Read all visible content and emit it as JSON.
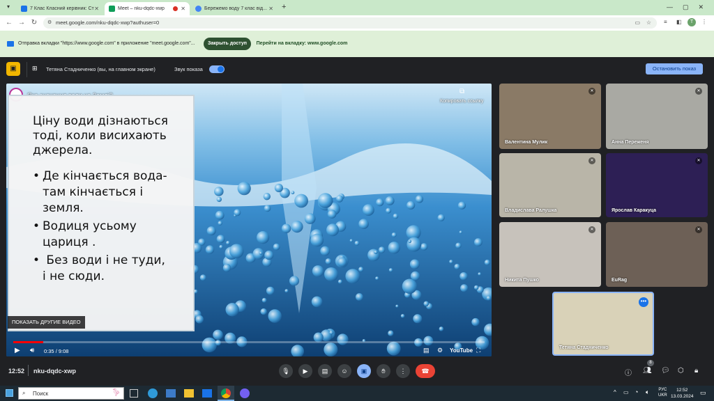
{
  "browser": {
    "tabs": [
      {
        "label": "7 Клас Класний керівник: Ста...",
        "color": "#1a73e8"
      },
      {
        "label": "Meet – nku-dqdc-xwp",
        "color": "#0f9d58"
      },
      {
        "label": "Бережемо воду 7 клас від...",
        "color": "#4285f4"
      }
    ],
    "new_tab": "+",
    "url": "meet.google.com/nku-dqdc-xwp?authuser=0",
    "profile_initial": "T"
  },
  "infobar": {
    "message": "Отправка вкладки \"https://www.google.com\" в приложение \"meet.google.com\"...",
    "close_access": "Закрыть доступ",
    "go_tab": "Перейти на вкладку: www.google.com"
  },
  "meet_top": {
    "presenter": "Тетяна Стадниченко (вы, на главном экране)",
    "sound_label": "Звук показа",
    "stop_button": "Остановить показ"
  },
  "video": {
    "title": "Яке значення води на Землі?",
    "copy_link": "Копировать ссылку",
    "more_videos": "ПОКАЗАТЬ ДРУГИЕ ВИДЕО",
    "time_current": "0:35",
    "time_total": "9:08",
    "progress": 0.064,
    "youtube": "YouTube",
    "slide_lines": [
      "Ціну води дізнаються",
      "тоді, коли висихають",
      "джерела."
    ],
    "bullets": [
      [
        "Де кінчається вода-",
        "там кінчається і",
        "земля."
      ],
      [
        "Водиця усьому",
        "цариця ."
      ],
      [
        " Без води і не туди,",
        "і не сюди."
      ]
    ]
  },
  "participants": [
    {
      "name": "Валентина Мулик",
      "bg": "#8a7a66"
    },
    {
      "name": "Анна Переженя",
      "bg": "#a9a9a3"
    },
    {
      "name": "Владислава Ралушка",
      "bg": "#b9b5a8"
    },
    {
      "name": "Ярослав Каракуца",
      "bg": "#2d1f55"
    },
    {
      "name": "Никита Пушко",
      "bg": "#c7c2bb"
    },
    {
      "name": "EuRag",
      "bg": "#6d6056"
    },
    {
      "name": "Тетяна Стадниченко",
      "bg": "#d9d2b8"
    }
  ],
  "bottom": {
    "time": "12:52",
    "meeting_code": "nku-dqdc-xwp",
    "people_count": "8"
  },
  "taskbar": {
    "search": "Поиск",
    "lang": "РУС",
    "lang2": "UKR",
    "clock": "12:52",
    "date": "13.03.2024"
  }
}
